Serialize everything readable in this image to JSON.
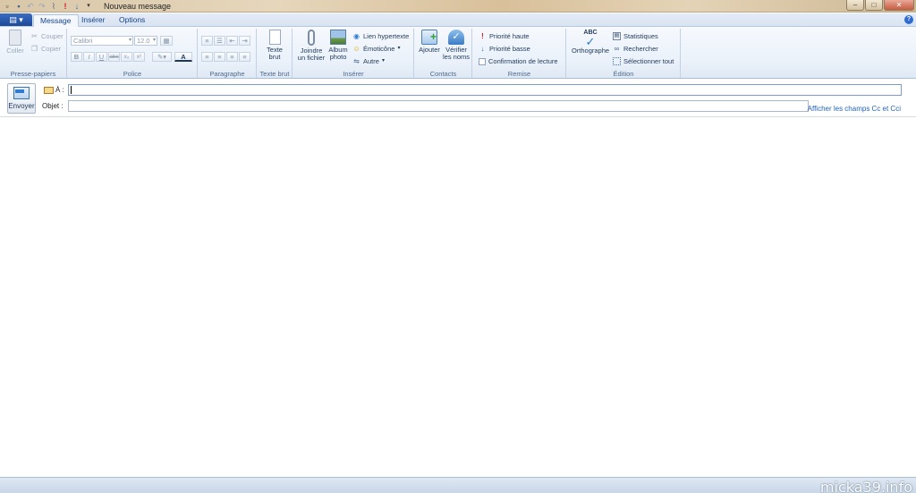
{
  "window": {
    "title": "Nouveau message",
    "controls": {
      "minimize": "–",
      "maximize": "□",
      "close": "✕"
    }
  },
  "qat_icons": [
    "new-icon",
    "save-icon",
    "undo-icon",
    "redo-icon",
    "attach-icon",
    "high-priority-icon",
    "low-priority-icon",
    "customize-icon"
  ],
  "tabs": [
    {
      "label": "Message",
      "active": true
    },
    {
      "label": "Insérer",
      "active": false
    },
    {
      "label": "Options",
      "active": false
    }
  ],
  "ribbon": {
    "clipboard": {
      "label": "Presse-papiers",
      "paste": "Coller",
      "cut": "Couper",
      "copy": "Copier"
    },
    "font": {
      "label": "Police",
      "family": "Calibri",
      "size": "12.0",
      "bold": "B",
      "italic": "I",
      "underline": "U",
      "strike": "abc",
      "subscript": "x₂",
      "superscript": "x²",
      "color_letter": "A"
    },
    "paragraph": {
      "label": "Paragraphe"
    },
    "plaintext": {
      "label": "Texte brut",
      "button_line1": "Texte",
      "button_line2": "brut"
    },
    "insert": {
      "label": "Insérer",
      "attach_line1": "Joindre",
      "attach_line2": "un fichier",
      "album_line1": "Album",
      "album_line2": "photo",
      "hyperlink": "Lien hypertexte",
      "emoticon": "Émoticône",
      "other": "Autre"
    },
    "contacts": {
      "label": "Contacts",
      "add": "Ajouter",
      "check_line1": "Vérifier",
      "check_line2": "les noms"
    },
    "delivery": {
      "label": "Remise",
      "high": "Priorité haute",
      "low": "Priorité basse",
      "receipt": "Confirmation de lecture"
    },
    "editing": {
      "label": "Édition",
      "spelling_badge": "ABC",
      "spelling": "Orthographe",
      "stats": "Statistiques",
      "find": "Rechercher",
      "select_all": "Sélectionner tout"
    }
  },
  "header": {
    "send": "Envoyer",
    "to_label": "À :",
    "to_value": "",
    "subject_label": "Objet :",
    "subject_value": "",
    "cc_link": "Afficher les champs Cc et Cci"
  },
  "watermark": "micka39.info",
  "colors": {
    "accent": "#1d4a96",
    "link": "#2563b5",
    "priority_high": "#d21f1f",
    "priority_low": "#2e6fd0"
  }
}
